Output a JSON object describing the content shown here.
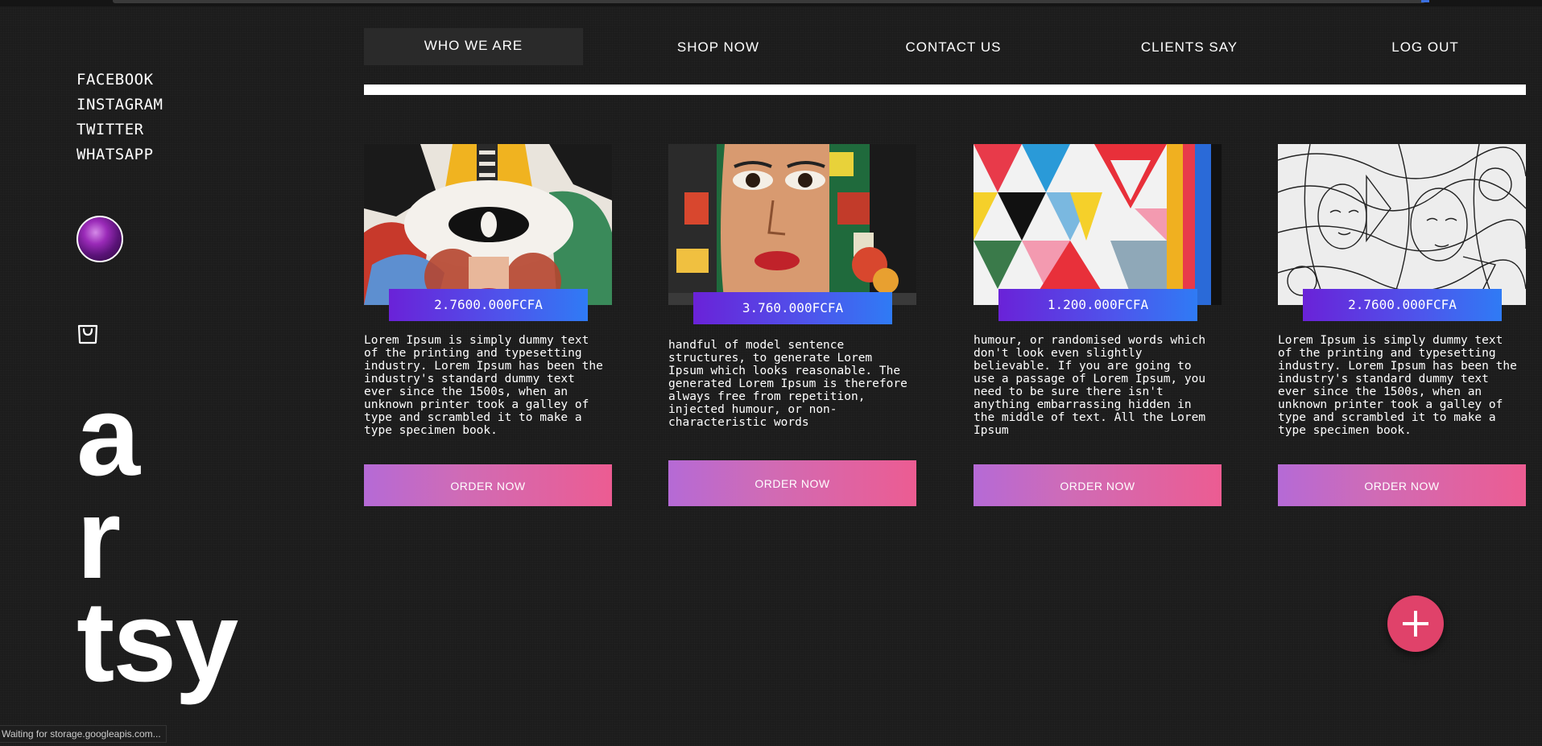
{
  "social": [
    "FACEBOOK",
    "INSTAGRAM",
    "TWITTER",
    "WHATSAPP"
  ],
  "brand": [
    "a",
    "r",
    "tsy"
  ],
  "nav": [
    "WHO WE ARE",
    "SHOP NOW",
    "CONTACT US",
    "CLIENTS SAY",
    "LOG OUT"
  ],
  "cards": [
    {
      "price": "2.7600.000FCFA",
      "desc": "Lorem Ipsum is simply dummy text\nof the printing and typesetting\nindustry. Lorem Ipsum has been the\nindustry's standard dummy text\never since the 1500s, when an\nunknown printer took a galley of\ntype and scrambled it to make a\ntype specimen book.",
      "order": "ORDER NOW"
    },
    {
      "price": "3.760.000FCFA",
      "desc": "handful of model sentence\nstructures, to generate Lorem\nIpsum which looks reasonable. The\ngenerated Lorem Ipsum is therefore\nalways free from repetition,\ninjected humour, or non-\ncharacteristic words",
      "order": "ORDER NOW"
    },
    {
      "price": "1.200.000FCFA",
      "desc": "humour, or randomised words which\ndon't look even slightly\nbelievable. If you are going to\nuse a passage of Lorem Ipsum, you\nneed to be sure there isn't\nanything embarrassing hidden in\nthe middle of text. All the Lorem\nIpsum",
      "order": "ORDER NOW"
    },
    {
      "price": "2.7600.000FCFA",
      "desc": "Lorem Ipsum is simply dummy text\nof the printing and typesetting\nindustry. Lorem Ipsum has been the\nindustry's standard dummy text\never since the 1500s, when an\nunknown printer took a galley of\ntype and scrambled it to make a\ntype specimen book.",
      "order": "ORDER NOW"
    }
  ],
  "status": "Waiting for storage.googleapis.com...",
  "colors": {
    "price_gradient": [
      "#6a22d8",
      "#2f7bf5"
    ],
    "order_gradient": [
      "#b56ad6",
      "#ec5c92"
    ],
    "fab": "#e0426a"
  },
  "icons": {
    "bag": "shopping-bag-icon",
    "fab": "plus-icon"
  }
}
